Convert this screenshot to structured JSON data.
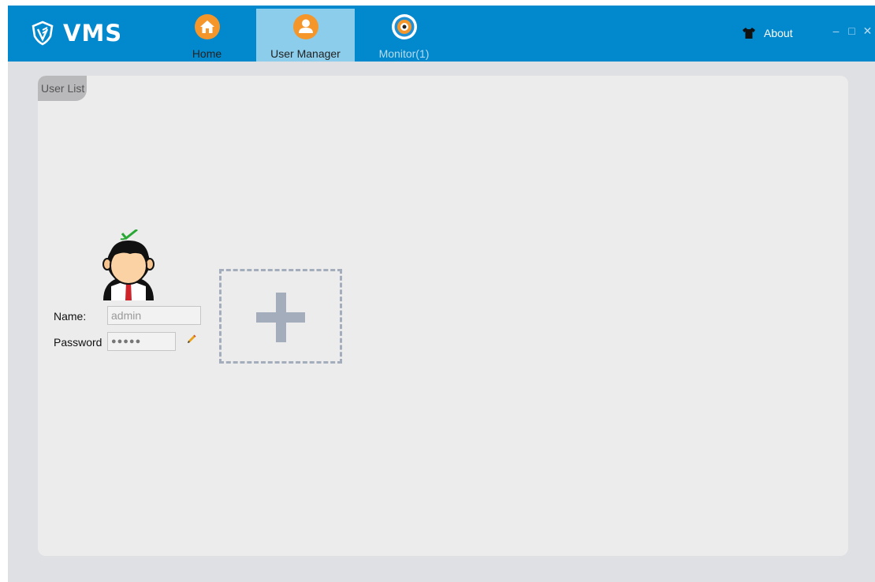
{
  "app": {
    "title": "VMS"
  },
  "tabs": [
    {
      "label": "Home",
      "icon": "home-icon",
      "selected": false
    },
    {
      "label": "User Manager",
      "icon": "user-icon",
      "selected": true
    },
    {
      "label": "Monitor(1)",
      "icon": "monitor-icon",
      "selected": false
    }
  ],
  "header": {
    "about_label": "About"
  },
  "window_controls": {
    "minimize": "–",
    "maximize": "□",
    "close": "✕"
  },
  "panel": {
    "tab_label": "User List"
  },
  "user_card": {
    "name_label": "Name:",
    "name_value": "admin",
    "password_label": "Password",
    "password_value": "●●●●●"
  },
  "colors": {
    "titlebar": "#0288cd",
    "selected_tab": "#8bcdeb",
    "tab_icon_orange": "#f5962a",
    "background": "#dfe0e3",
    "panel": "#ececec",
    "add_box": "#a3adbb"
  }
}
